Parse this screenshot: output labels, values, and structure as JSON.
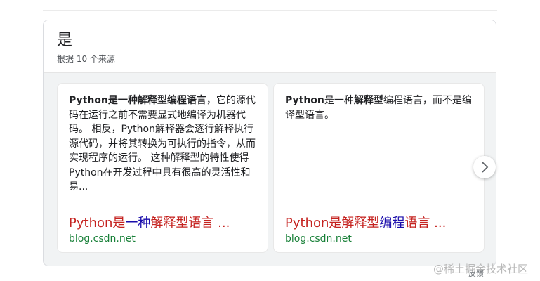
{
  "answer": {
    "title": "是",
    "subtitle": "根据 10 个来源"
  },
  "cards": [
    {
      "snippet": {
        "bold": "Python是一种解释型编程语言",
        "text": "，它的源代码在运行之前不需要显式地编译为机器代码。 相反，Python解释器会逐行解释执行源代码，并将其转换为可执行的指令，从而实现程序的运行。 这种解释型的特性使得Python在开发过程中具有很高的灵活性和易..."
      },
      "source_title": {
        "prefix": "Python是",
        "blue": "一种",
        "suffix": "解释型语言 ..."
      },
      "source_url": "blog.csdn.net"
    },
    {
      "snippet": {
        "bold1": "Python",
        "text1": "是一种",
        "bold2": "解释型",
        "text2": "编程语言，而不是编译型语言。"
      },
      "source_title": {
        "prefix": "Python是解释型",
        "blue": "编程",
        "suffix": "语言 ..."
      },
      "source_url": "blog.csdn.net"
    }
  ],
  "carousel": {
    "next_icon": "chevron-right-icon"
  },
  "feedback_label": "反馈",
  "watermark": "@稀土掘金技术社区",
  "colors": {
    "source_title_red": "#c5221f",
    "source_title_blue": "#1a0dab",
    "url_green": "#188038"
  }
}
